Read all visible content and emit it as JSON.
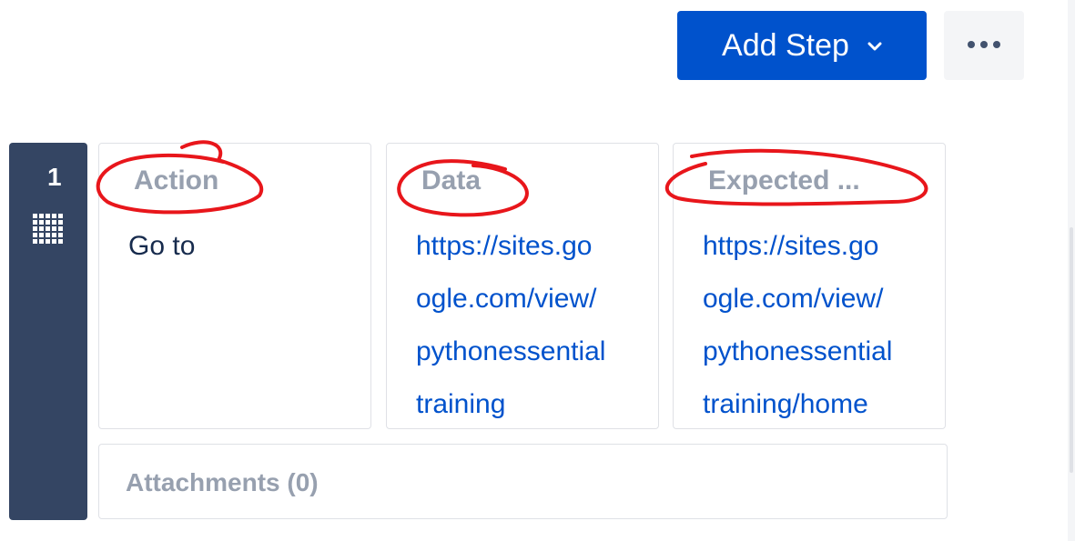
{
  "toolbar": {
    "add_step_label": "Add Step",
    "add_step_icon": "chevron-down-icon",
    "more_icon": "more-horizontal-icon",
    "accent_color": "#0052cc"
  },
  "step": {
    "number": "1",
    "drag_icon": "drag-grid-icon",
    "action": {
      "label": "Action",
      "value": "Go to"
    },
    "data": {
      "label": "Data",
      "value_lines": [
        "https://sites.go",
        "ogle.com/view/",
        "pythonessential",
        "training"
      ]
    },
    "expected": {
      "label": "Expected ...",
      "value_lines": [
        "https://sites.go",
        "ogle.com/view/",
        "pythonessential",
        "training/home"
      ]
    },
    "attachments_label": "Attachments (0)"
  },
  "annotation_color": "#e8161b"
}
